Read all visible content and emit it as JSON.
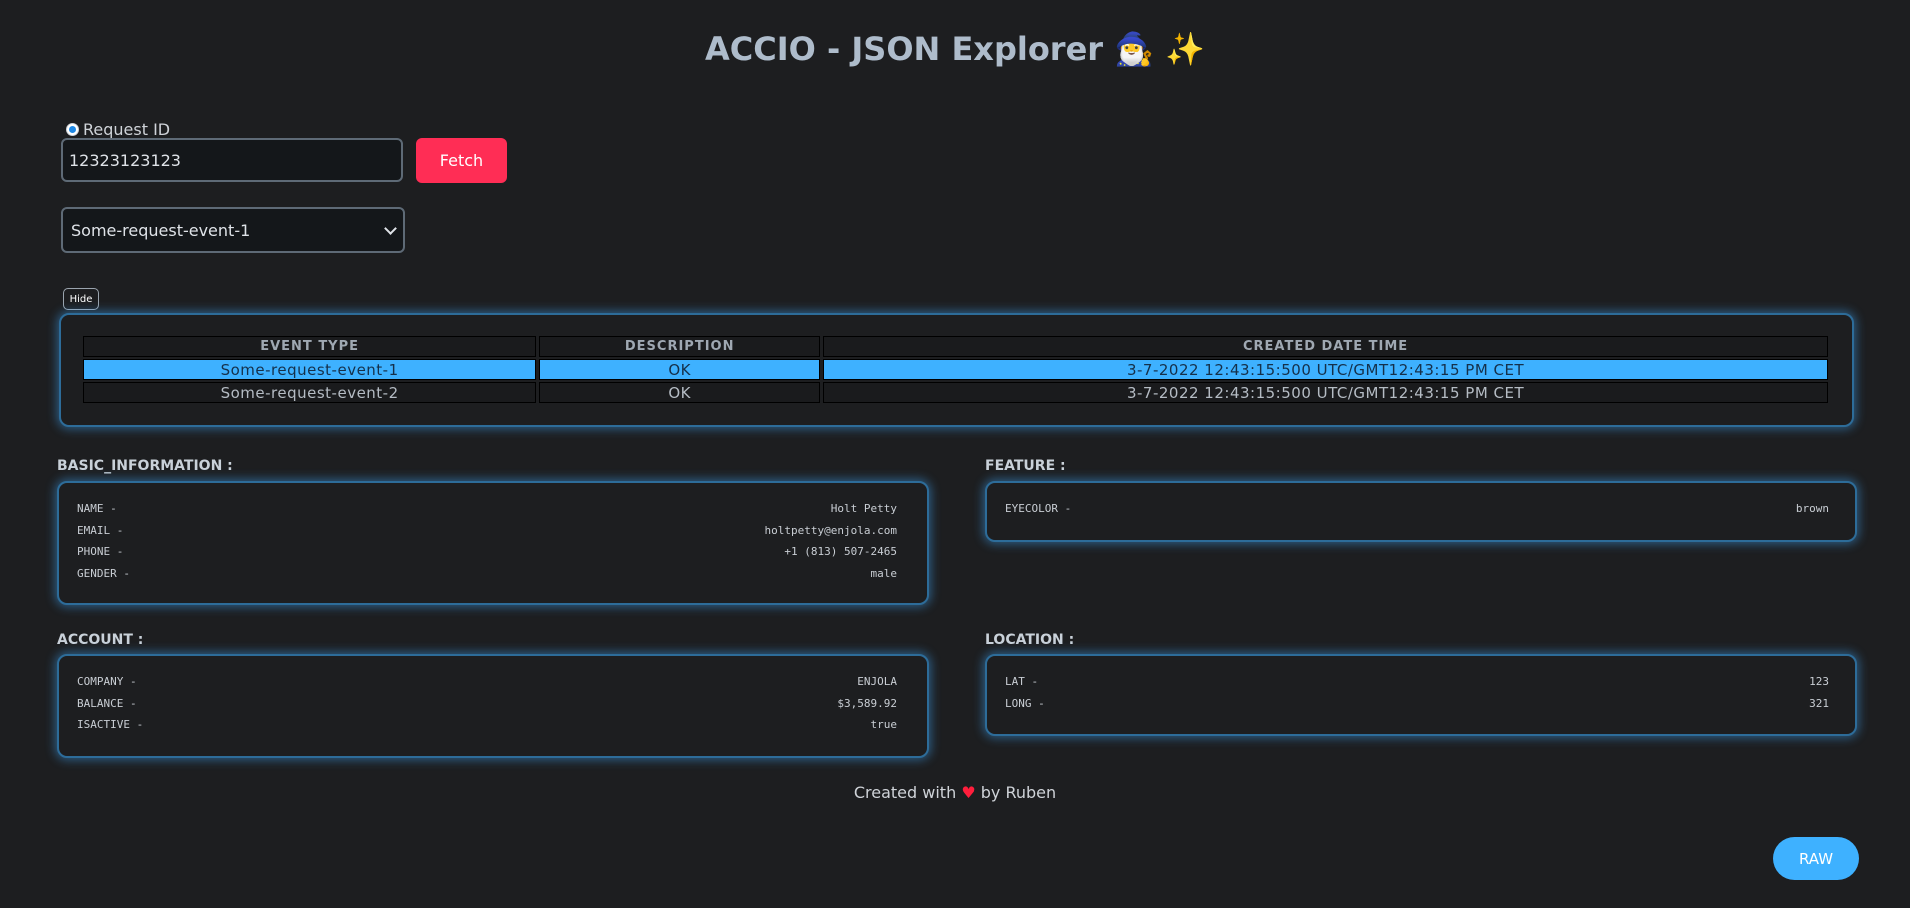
{
  "header": {
    "title": "ACCIO - JSON Explorer 🧙‍♂️ ✨"
  },
  "search": {
    "mode_label": "Request ID",
    "request_id": "12323123123",
    "fetch_label": "Fetch",
    "selected_event": "Some-request-event-1"
  },
  "events": {
    "hide_label": "Hide",
    "columns": [
      "EVENT TYPE",
      "DESCRIPTION",
      "CREATED DATE TIME"
    ],
    "rows": [
      {
        "event_type": "Some-request-event-1",
        "description": "OK",
        "created": "3-7-2022 12:43:15:500 UTC/GMT12:43:15 PM CET",
        "selected": true
      },
      {
        "event_type": "Some-request-event-2",
        "description": "OK",
        "created": "3-7-2022 12:43:15:500 UTC/GMT12:43:15 PM CET",
        "selected": false
      }
    ]
  },
  "basic_information": {
    "label": "BASIC_INFORMATION :",
    "items": [
      {
        "key": "NAME -",
        "value": "Holt Petty"
      },
      {
        "key": "EMAIL -",
        "value": "holtpetty@enjola.com"
      },
      {
        "key": "PHONE -",
        "value": "+1 (813) 507-2465"
      },
      {
        "key": "GENDER -",
        "value": "male"
      }
    ]
  },
  "feature": {
    "label": "FEATURE :",
    "items": [
      {
        "key": "EYECOLOR -",
        "value": "brown"
      }
    ]
  },
  "account": {
    "label": "ACCOUNT :",
    "items": [
      {
        "key": "COMPANY -",
        "value": "ENJOLA"
      },
      {
        "key": "BALANCE -",
        "value": "$3,589.92"
      },
      {
        "key": "ISACTIVE -",
        "value": "true"
      }
    ]
  },
  "location": {
    "label": "LOCATION :",
    "items": [
      {
        "key": "LAT -",
        "value": "123"
      },
      {
        "key": "LONG -",
        "value": "321"
      }
    ]
  },
  "footer": {
    "prefix": "Created with",
    "heart": "♥",
    "suffix": "by Ruben"
  },
  "raw_label": "RAW",
  "colors": {
    "fetch": "#ff2d55",
    "accent": "#3eb1ff",
    "background": "#1d1e20"
  }
}
